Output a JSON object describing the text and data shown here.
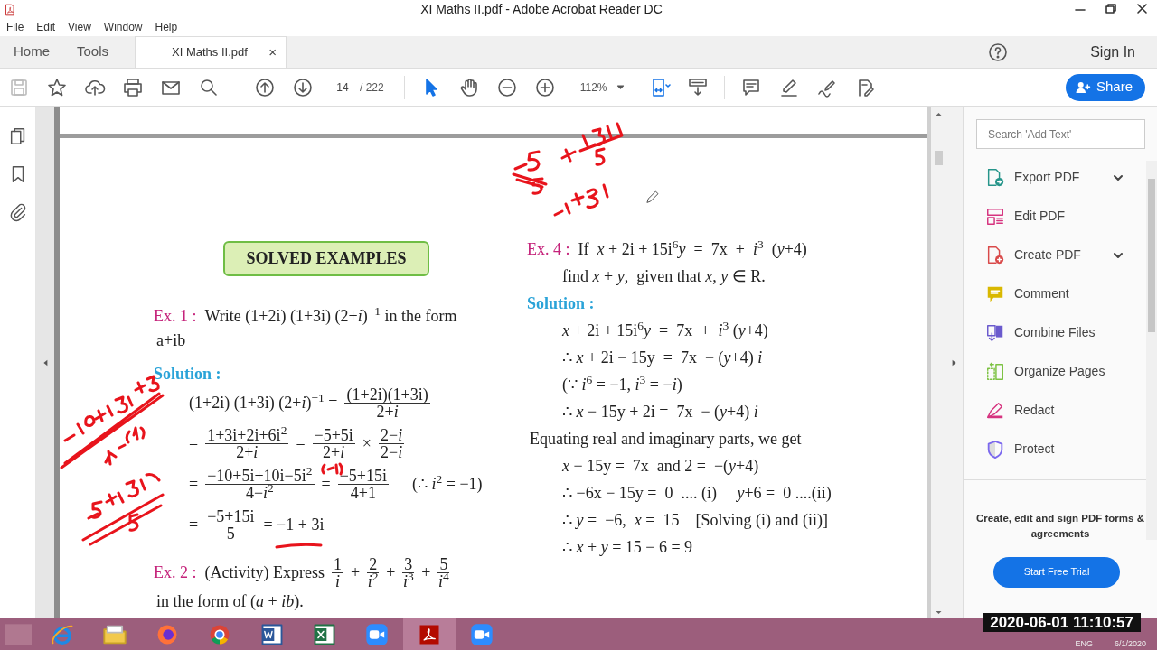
{
  "window": {
    "title": "XI Maths II.pdf - Adobe Acrobat Reader DC"
  },
  "menu": [
    "File",
    "Edit",
    "View",
    "Window",
    "Help"
  ],
  "tabs": [
    {
      "label": "Home",
      "selected": false,
      "kind": "nav"
    },
    {
      "label": "Tools",
      "selected": false,
      "kind": "nav"
    },
    {
      "label": "XI Maths II.pdf",
      "selected": true,
      "kind": "document",
      "close": "×"
    }
  ],
  "account": {
    "sign_in": "Sign In"
  },
  "toolbar": {
    "page": "14",
    "page_total": "/ 222",
    "zoom": "112%",
    "pointer_tools": [
      {
        "selected": true
      },
      {
        "selected": false
      }
    ],
    "share": "Share"
  },
  "document": {
    "left": [
      {
        "kind": "banner",
        "text": "SOLVED EXAMPLES"
      },
      {
        "kind": "example",
        "label": "Ex. 1 :",
        "segs": [
          {
            "kind": "text",
            "t": "Write (1+2i) (1+3i) (2+*i*)$^{−1}$ in the form"
          }
        ]
      },
      {
        "kind": "para",
        "segs": [
          {
            "kind": "text",
            "t": "a+ib"
          }
        ]
      },
      {
        "kind": "solution",
        "label": "Solution :"
      },
      {
        "kind": "eq",
        "segs": [
          {
            "kind": "text",
            "t": "(1+2i) (1+3i) (2+*i*)$^{−1}$ ="
          },
          {
            "kind": "frac",
            "num": "(1+2i)(1+3i)",
            "den": "2+*i*"
          }
        ]
      },
      {
        "kind": "eq",
        "segs": [
          {
            "kind": "text",
            "t": "="
          },
          {
            "kind": "frac",
            "num": "1+3i+2i+6i$^{2}$",
            "den": "2+*i*"
          },
          {
            "kind": "text",
            "t": "="
          },
          {
            "kind": "frac",
            "num": "−5+5i",
            "den": "2+*i*"
          },
          {
            "kind": "text",
            "t": "×"
          },
          {
            "kind": "frac",
            "num": "2−*i*",
            "den": "2−*i*"
          }
        ]
      },
      {
        "kind": "eq",
        "segs": [
          {
            "kind": "text",
            "t": "="
          },
          {
            "kind": "frac",
            "num": "−10+5i+10i−5i$^{2}$",
            "den": "4−*i*$^{2}$"
          },
          {
            "kind": "text",
            "t": "="
          },
          {
            "kind": "frac",
            "num": "−5+15i",
            "den": "4+1"
          },
          {
            "kind": "text",
            "t": "    (∴ *i*$^{2}$ = −1)"
          }
        ]
      },
      {
        "kind": "eq",
        "segs": [
          {
            "kind": "text",
            "t": "="
          },
          {
            "kind": "frac",
            "num": "−5+15i",
            "den": "5"
          },
          {
            "kind": "text",
            "t": "= −1 + 3i"
          }
        ]
      },
      {
        "kind": "example",
        "label": "Ex. 2 :",
        "segs": [
          {
            "kind": "text",
            "t": "(Activity) Express"
          },
          {
            "kind": "frac",
            "num": "1",
            "den": "*i*"
          },
          {
            "kind": "text",
            "t": "+"
          },
          {
            "kind": "frac",
            "num": "2",
            "den": "*i*$^{2}$"
          },
          {
            "kind": "text",
            "t": "+"
          },
          {
            "kind": "frac",
            "num": "3",
            "den": "*i*$^{3}$"
          },
          {
            "kind": "text",
            "t": "+"
          },
          {
            "kind": "frac",
            "num": "5",
            "den": "*i*$^{4}$"
          }
        ]
      },
      {
        "kind": "para",
        "segs": [
          {
            "kind": "text",
            "t": "in the form of (*a* + *ib*)."
          }
        ]
      }
    ],
    "right": [
      {
        "kind": "example",
        "label": "Ex. 4 :",
        "segs": [
          {
            "kind": "text",
            "t": "If  *x* + 2i + 15i$^{6}$*y*  =  7x  +  *i*$^{3}$  (*y*+4)"
          }
        ]
      },
      {
        "kind": "eq",
        "segs": [
          {
            "kind": "text",
            "t": "find *x* + *y*,  given that *x*, *y* ∈ R."
          }
        ]
      },
      {
        "kind": "solution",
        "label": "Solution :"
      },
      {
        "kind": "eq",
        "segs": [
          {
            "kind": "text",
            "t": "*x* + 2i + 15i$^{6}$*y*  =  7x  +  *i*$^{3}$ (*y*+4)"
          }
        ]
      },
      {
        "kind": "eq",
        "segs": [
          {
            "kind": "text",
            "t": "∴ *x* + 2i − 15y  =  7x  − (*y*+4) *i*"
          }
        ]
      },
      {
        "kind": "eq",
        "segs": [
          {
            "kind": "text",
            "t": "(∵ *i*$^{6}$ = −1, *i*$^{3}$ = −*i*)"
          }
        ]
      },
      {
        "kind": "eq",
        "segs": [
          {
            "kind": "text",
            "t": "∴ *x* − 15y + 2i =  7x  − (*y*+4) *i*"
          }
        ]
      },
      {
        "kind": "para",
        "segs": [
          {
            "kind": "text",
            "t": "Equating real and imaginary parts, we get"
          }
        ]
      },
      {
        "kind": "eq",
        "segs": [
          {
            "kind": "text",
            "t": "*x* − 15y =  7x  and 2 =  −(*y*+4)"
          }
        ]
      },
      {
        "kind": "eq",
        "segs": [
          {
            "kind": "text",
            "t": "∴ −6x − 15y =  0  .... (i)     *y*+6 =  0 ....(ii)"
          }
        ]
      },
      {
        "kind": "eq",
        "segs": [
          {
            "kind": "text",
            "t": "∴ *y* =  −6,  *x* =  15    [Solving (i) and (ii)]"
          }
        ]
      },
      {
        "kind": "eq",
        "segs": [
          {
            "kind": "text",
            "t": "∴ *x* + *y* = 15 − 6 = 9"
          }
        ]
      }
    ]
  },
  "tools_panel": {
    "search": {
      "placeholder": "Search 'Add Text'"
    },
    "items": [
      {
        "label": "Export PDF",
        "has_menu": true,
        "color": "#26958a"
      },
      {
        "label": "Edit PDF",
        "has_menu": false,
        "color": "#d6337f"
      },
      {
        "label": "Create PDF",
        "has_menu": true,
        "color": "#d94a4a"
      },
      {
        "label": "Comment",
        "has_menu": false,
        "color": "#d9b800"
      },
      {
        "label": "Combine Files",
        "has_menu": false,
        "color": "#6a5acd"
      },
      {
        "label": "Organize Pages",
        "has_menu": false,
        "color": "#7cc242"
      },
      {
        "label": "Redact",
        "has_menu": false,
        "color": "#d6337f"
      },
      {
        "label": "Protect",
        "has_menu": false,
        "color": "#7b68ee"
      }
    ],
    "promo": "Create, edit and sign PDF forms & agreements",
    "trial_button": "Start Free Trial"
  },
  "taskbar": {
    "apps": [
      {
        "kind": "ie",
        "selected": false
      },
      {
        "kind": "folder",
        "selected": false
      },
      {
        "kind": "firefox",
        "selected": false
      },
      {
        "kind": "chrome",
        "selected": false
      },
      {
        "kind": "word",
        "selected": false
      },
      {
        "kind": "excel",
        "selected": false
      },
      {
        "kind": "zoom",
        "selected": false
      },
      {
        "kind": "acrobat",
        "selected": true
      },
      {
        "kind": "zoom",
        "selected": false
      }
    ],
    "timestamp": "2020-06-01 11:10:57",
    "language": "ENG",
    "date": "6/1/2020"
  }
}
